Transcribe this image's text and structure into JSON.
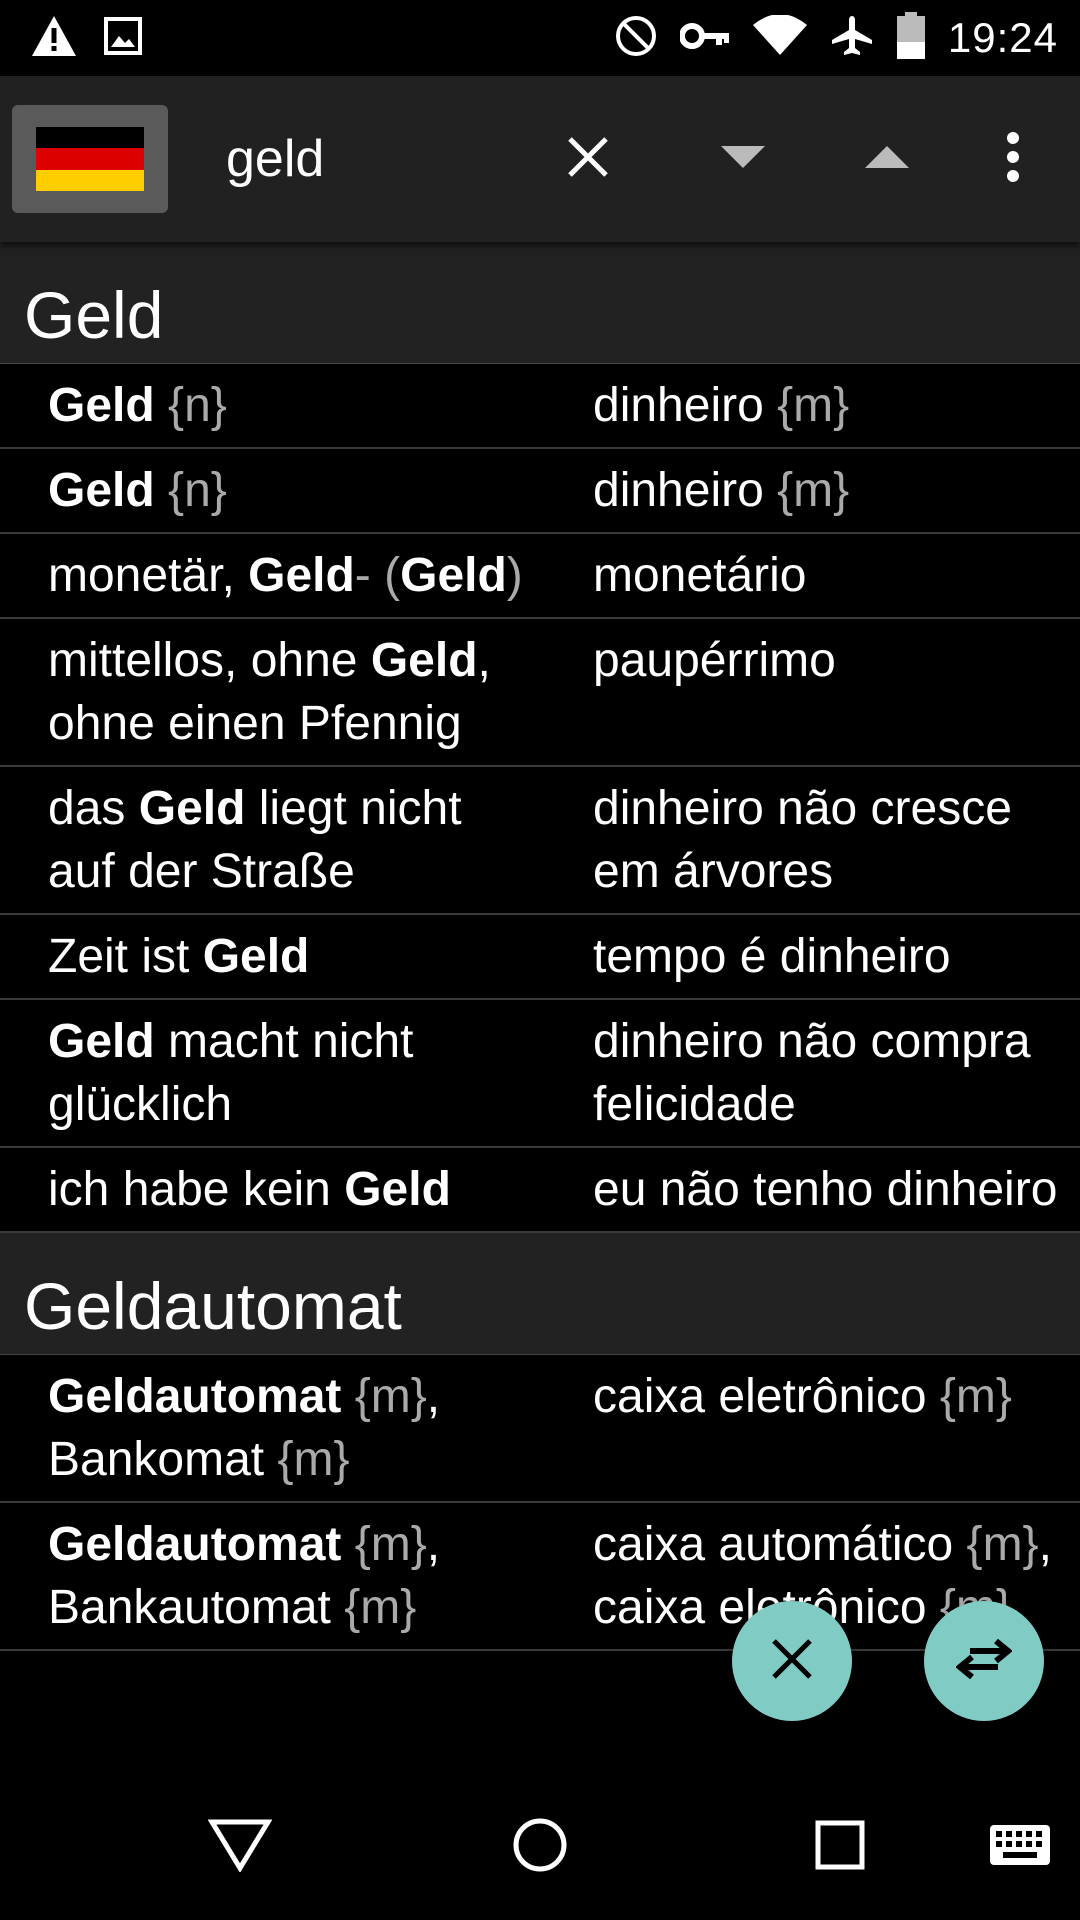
{
  "status_bar": {
    "time": "19:24",
    "left_icons": [
      "warning-icon",
      "image-icon"
    ],
    "right_icons": [
      "do-not-disturb-icon",
      "vpn-key-icon",
      "wifi-icon",
      "airplane-icon",
      "battery-icon"
    ]
  },
  "toolbar": {
    "language_flag": "germany-flag",
    "search_value": "geld",
    "icons": [
      "close-icon",
      "arrow-down-icon",
      "arrow-up-icon",
      "more-vert-icon"
    ]
  },
  "sections": [
    {
      "title": "Geld",
      "rows": [
        {
          "de": [
            {
              "t": "Geld",
              "b": true
            },
            {
              "t": " "
            },
            {
              "t": "{n}",
              "m": true
            }
          ],
          "pt": [
            {
              "t": "dinheiro "
            },
            {
              "t": "{m}",
              "m": true
            }
          ]
        },
        {
          "de": [
            {
              "t": "Geld",
              "b": true
            },
            {
              "t": " "
            },
            {
              "t": "{n}",
              "m": true
            }
          ],
          "pt": [
            {
              "t": "dinheiro "
            },
            {
              "t": "{m}",
              "m": true
            }
          ]
        },
        {
          "de": [
            {
              "t": "monetär, "
            },
            {
              "t": "Geld",
              "b": true
            },
            {
              "t": "-",
              "m": true
            },
            {
              "t": " "
            },
            {
              "t": "(",
              "m": true
            },
            {
              "t": "Geld",
              "b": true
            },
            {
              "t": ")",
              "m": true
            }
          ],
          "pt": [
            {
              "t": "monetário"
            }
          ]
        },
        {
          "de": [
            {
              "t": "mittellos, ohne "
            },
            {
              "t": "Geld",
              "b": true
            },
            {
              "t": ", ohne einen Pfennig"
            }
          ],
          "pt": [
            {
              "t": "paupérrimo"
            }
          ]
        },
        {
          "de": [
            {
              "t": "das "
            },
            {
              "t": "Geld",
              "b": true
            },
            {
              "t": " liegt nicht auf der Straße"
            }
          ],
          "pt": [
            {
              "t": "dinheiro não cresce em árvores"
            }
          ]
        },
        {
          "de": [
            {
              "t": "Zeit ist "
            },
            {
              "t": "Geld",
              "b": true
            }
          ],
          "pt": [
            {
              "t": "tempo é dinheiro"
            }
          ]
        },
        {
          "de": [
            {
              "t": "Geld",
              "b": true
            },
            {
              "t": " macht nicht glücklich"
            }
          ],
          "pt": [
            {
              "t": "dinheiro não compra felicidade"
            }
          ]
        },
        {
          "de": [
            {
              "t": "ich habe kein "
            },
            {
              "t": "Geld",
              "b": true
            }
          ],
          "pt": [
            {
              "t": "eu não tenho dinheiro"
            }
          ]
        }
      ]
    },
    {
      "title": "Geldautomat",
      "rows": [
        {
          "de": [
            {
              "t": "Geldautomat",
              "b": true
            },
            {
              "t": " "
            },
            {
              "t": "{m}",
              "m": true
            },
            {
              "t": ", Bankomat "
            },
            {
              "t": "{m}",
              "m": true
            }
          ],
          "pt": [
            {
              "t": "caixa eletrônico "
            },
            {
              "t": "{m}",
              "m": true
            }
          ]
        },
        {
          "de": [
            {
              "t": "Geldautomat",
              "b": true
            },
            {
              "t": " "
            },
            {
              "t": "{m}",
              "m": true
            },
            {
              "t": ", Bankautomat "
            },
            {
              "t": "{m}",
              "m": true
            }
          ],
          "pt": [
            {
              "t": "caixa automático "
            },
            {
              "t": "{m}",
              "m": true
            },
            {
              "t": ", caixa eletrônico "
            },
            {
              "t": "{m}",
              "m": true
            }
          ]
        }
      ]
    }
  ],
  "fabs": [
    "clear-icon",
    "swap-icon"
  ],
  "nav_bar": [
    "back-icon",
    "home-icon",
    "recents-icon",
    "keyboard-icon"
  ]
}
